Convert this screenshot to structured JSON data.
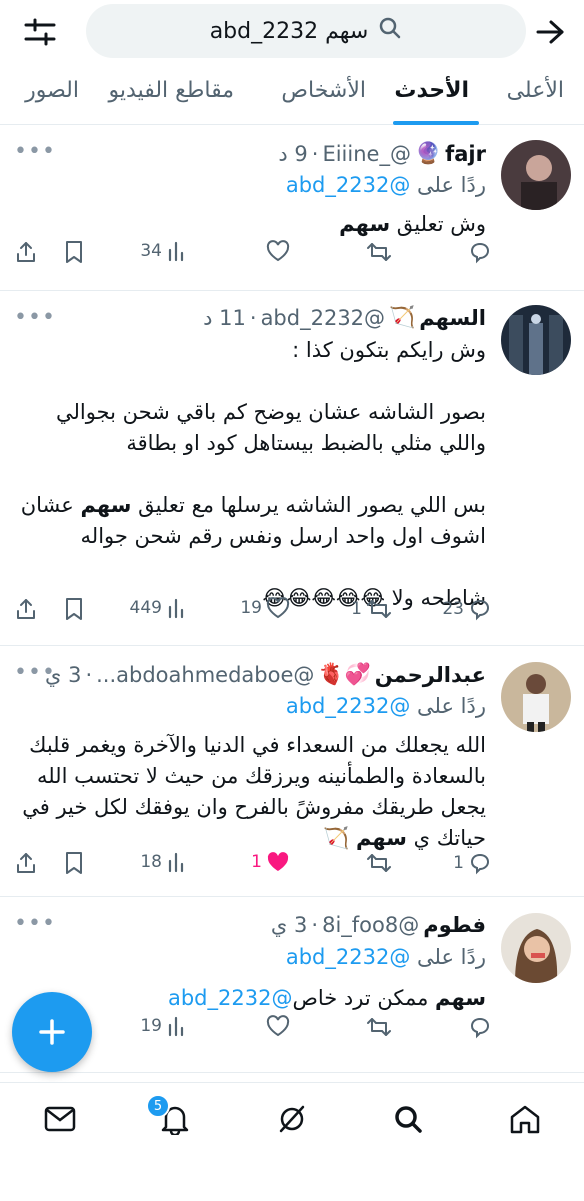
{
  "search": {
    "query": "سهم abd_2232"
  },
  "tabs": [
    {
      "label": "الأعلى"
    },
    {
      "label": "الأحدث"
    },
    {
      "label": "الأشخاص"
    },
    {
      "label": "مقاطع الفيديو"
    },
    {
      "label": "الصور"
    }
  ],
  "tweets": [
    {
      "name": "fajr",
      "emoji": "🔮",
      "handle": "@_Eiiine",
      "time": "9 د",
      "reply_prefix": "ردًا على",
      "reply_to": "@abd_2232",
      "text_a": "وش تعليق ",
      "text_b": "سهم",
      "replies": "",
      "retweets": "",
      "likes": "",
      "views": "34"
    },
    {
      "name": "السهم",
      "emoji": "🏹",
      "handle": "@abd_2232",
      "time": "11 د",
      "p1": "وش رايكم بتكون كذا :",
      "p2": "بصور الشاشه عشان يوضح كم باقي شحن بجوالي واللي مثلي بالضبط بيستاهل كود او بطاقة",
      "p3a": "بس اللي يصور الشاشه يرسلها مع تعليق ",
      "p3b": "سهم",
      "p3c": " عشان اشوف اول واحد ارسل ونفس رقم شحن جواله",
      "p4": "شاطحه ولا 😂😂😂😂😂",
      "replies": "23",
      "retweets": "1",
      "likes": "19",
      "views": "449"
    },
    {
      "name": "عبدالرحمن",
      "emoji": "💞🫀",
      "handle": "@abdoahmedaboe...",
      "time": "3 ي",
      "reply_prefix": "ردًا على",
      "reply_to": "@abd_2232",
      "text_a": "الله يجعلك من السعداء في الدنيا والآخرة ويغمر قلبك بالسعادة والطمأنينه ويرزقك من حيث لا تحتسب الله يجعل طريقك مفروشً بالفرح وان يوفقك لكل خير في حياتك ي ",
      "text_b": "سهم",
      "text_c": " 🏹",
      "replies": "1",
      "retweets": "",
      "likes": "1",
      "views": "18"
    },
    {
      "name": "فطوم",
      "emoji": "",
      "handle": "@8i_foo8",
      "time": "3 ي",
      "reply_prefix": "ردًا على",
      "reply_to": "@abd_2232",
      "text_a": "سهم",
      "text_b": " ممكن ترد خاص",
      "text_c": "@abd_2232",
      "replies": "",
      "retweets": "",
      "likes": "",
      "views": "19"
    }
  ],
  "bottom_nav": {
    "notifications_badge": "5"
  },
  "colors": {
    "accent": "#1d9bf0",
    "like_active": "#f91880",
    "text": "#0f1419",
    "muted": "#536471"
  }
}
